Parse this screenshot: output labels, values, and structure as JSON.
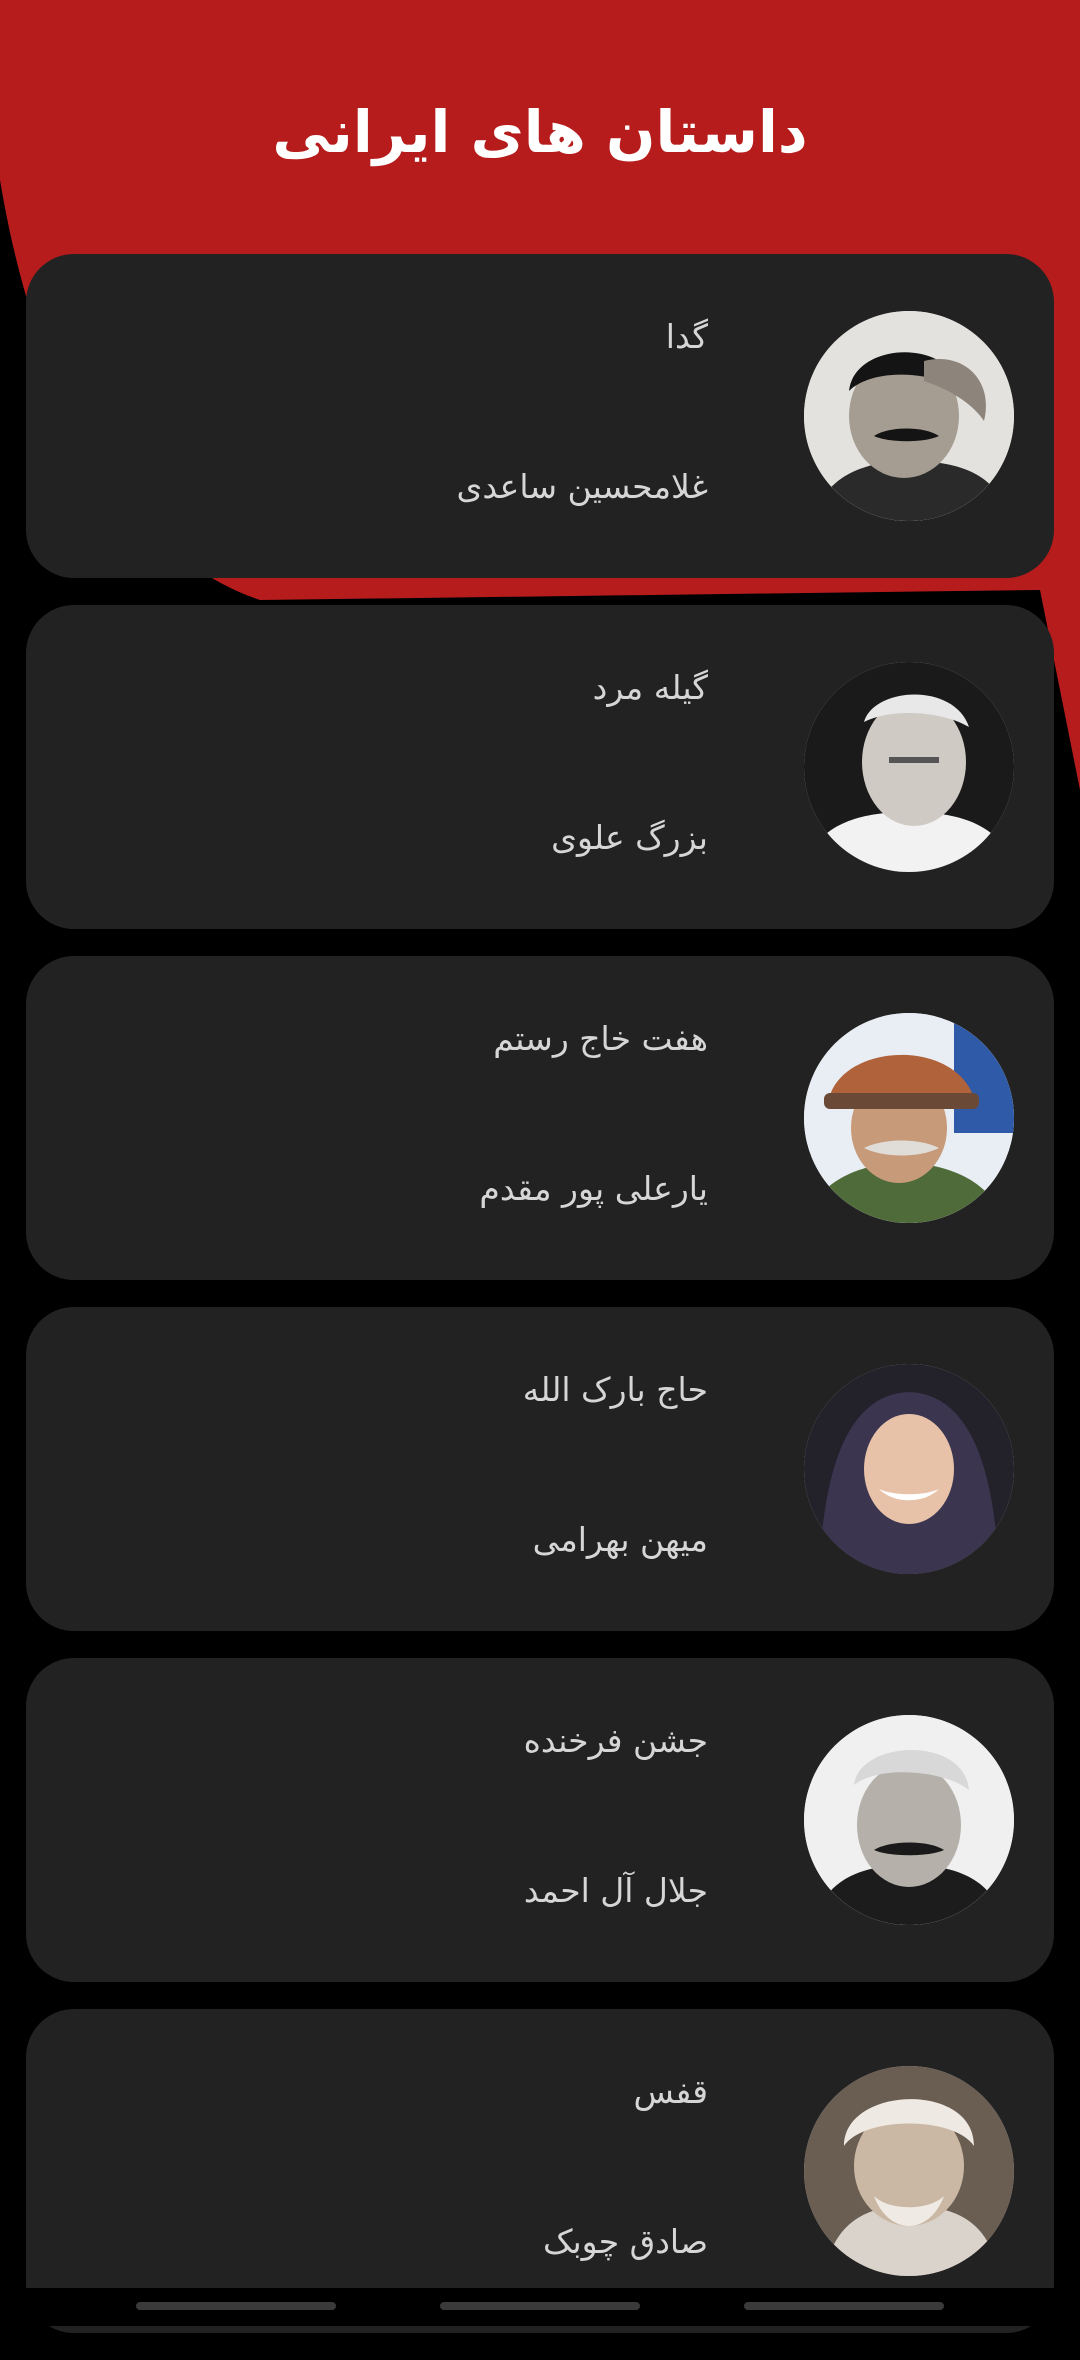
{
  "header": {
    "title": "داستان های ایرانی",
    "accent_color": "#B71C1C"
  },
  "stories": [
    {
      "title": "گدا",
      "author": "غلامحسین ساعدی",
      "avatar_icon": "author-portrait"
    },
    {
      "title": "گیله مرد",
      "author": "بزرگ علوی",
      "avatar_icon": "author-portrait"
    },
    {
      "title": "هفت خاج رستم",
      "author": "یارعلی پور مقدم",
      "avatar_icon": "author-portrait"
    },
    {
      "title": "حاج بارک الله",
      "author": "میهن بهرامی",
      "avatar_icon": "author-portrait"
    },
    {
      "title": "جشن فرخنده",
      "author": "جلال آل احمد",
      "avatar_icon": "author-portrait"
    },
    {
      "title": "قفس",
      "author": "صادق چوبک",
      "avatar_icon": "author-portrait"
    }
  ],
  "colors": {
    "background": "#000000",
    "card": "#222222",
    "text": "#D6D6D6"
  }
}
